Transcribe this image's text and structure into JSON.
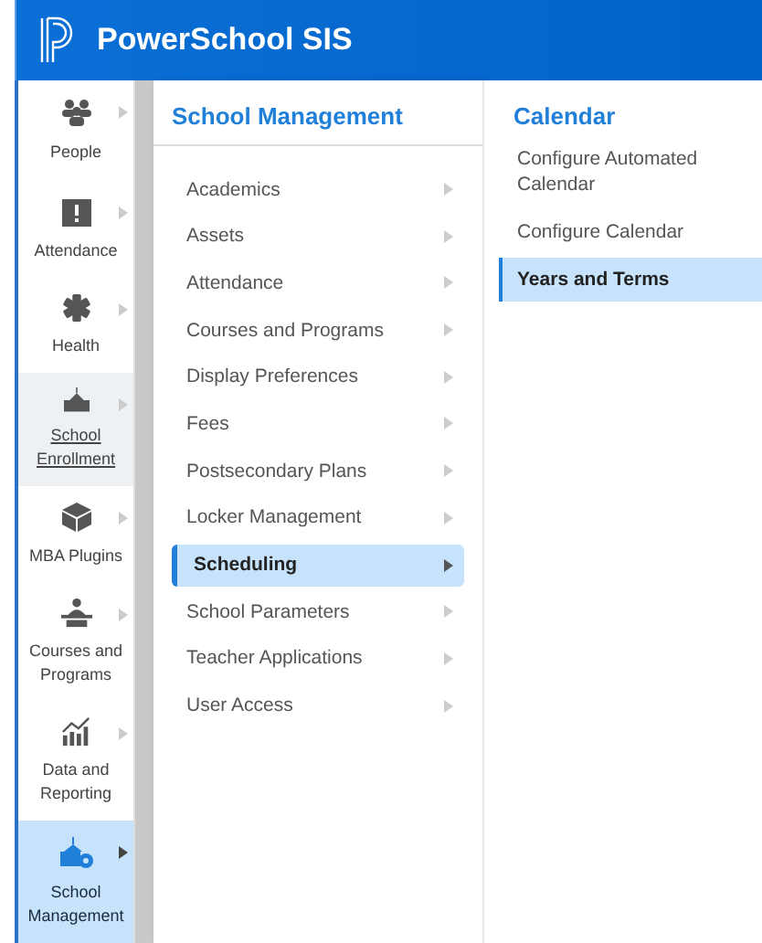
{
  "header": {
    "title": "PowerSchool SIS"
  },
  "sidebar": {
    "items": [
      {
        "label": "People",
        "kind": "people",
        "selected": false,
        "hovered": false
      },
      {
        "label": "Attendance",
        "kind": "attendance",
        "selected": false,
        "hovered": false
      },
      {
        "label": "Health",
        "kind": "health",
        "selected": false,
        "hovered": false
      },
      {
        "label": "School Enrollment",
        "kind": "school",
        "selected": false,
        "hovered": true
      },
      {
        "label": "MBA Plugins",
        "kind": "cube",
        "selected": false,
        "hovered": false
      },
      {
        "label": "Courses and Programs",
        "kind": "teacher",
        "selected": false,
        "hovered": false
      },
      {
        "label": "Data and Reporting",
        "kind": "chart",
        "selected": false,
        "hovered": false
      },
      {
        "label": "School Management",
        "kind": "schoolgear",
        "selected": true,
        "hovered": false
      }
    ]
  },
  "menu": {
    "title": "School Management",
    "items": [
      {
        "label": "Academics",
        "selected": false
      },
      {
        "label": "Assets",
        "selected": false
      },
      {
        "label": "Attendance",
        "selected": false
      },
      {
        "label": "Courses and Programs",
        "selected": false
      },
      {
        "label": "Display Preferences",
        "selected": false
      },
      {
        "label": "Fees",
        "selected": false
      },
      {
        "label": "Postsecondary Plans",
        "selected": false
      },
      {
        "label": "Locker Management",
        "selected": false
      },
      {
        "label": "Scheduling",
        "selected": true
      },
      {
        "label": "School Parameters",
        "selected": false
      },
      {
        "label": "Teacher Applications",
        "selected": false
      },
      {
        "label": "User Access",
        "selected": false
      }
    ]
  },
  "submenu": {
    "title": "Calendar",
    "items": [
      {
        "label": "Configure Automated Calendar",
        "selected": false
      },
      {
        "label": "Configure Calendar",
        "selected": false
      },
      {
        "label": "Years and Terms",
        "selected": true
      }
    ]
  }
}
